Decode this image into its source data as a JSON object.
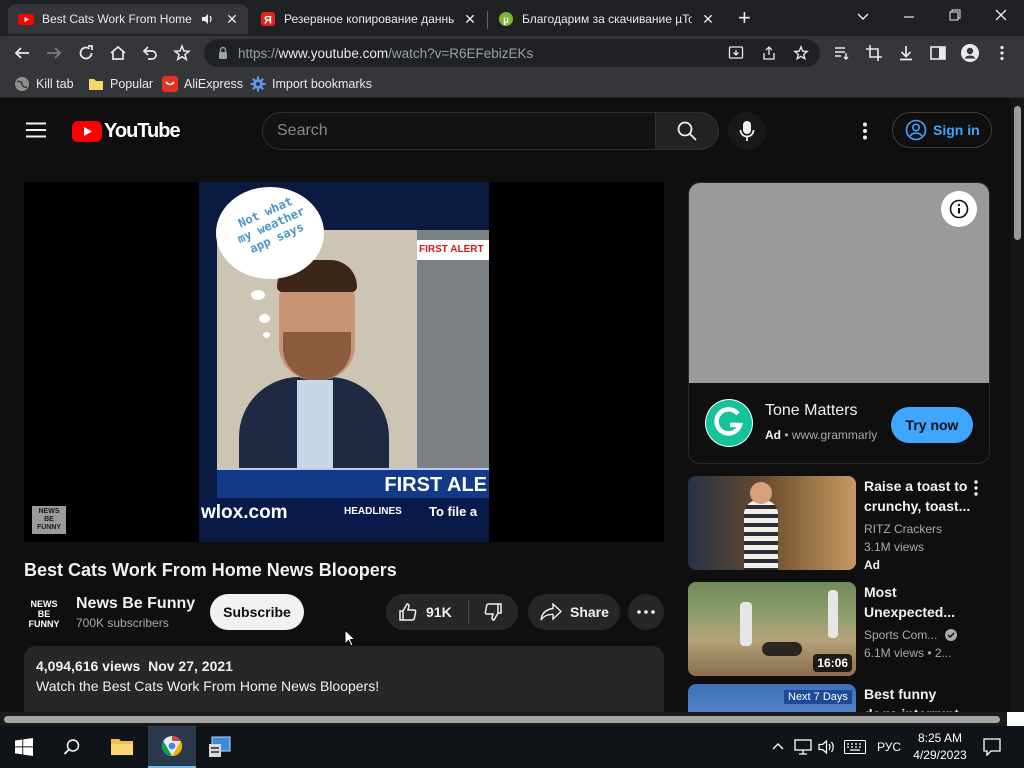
{
  "browser": {
    "tabs": [
      {
        "title": "Best Cats Work From Home",
        "close": "✕"
      },
      {
        "title": "Резервное копирование данны",
        "close": "✕"
      },
      {
        "title": "Благодарим за скачивание µTor",
        "close": "✕"
      }
    ],
    "new_tab": "+",
    "url_scheme": "https://",
    "url_host": "www.youtube.com",
    "url_path": "/watch?v=R6EFebizEKs",
    "bookmarks": [
      {
        "label": "Kill tab",
        "icon": "globe-icon"
      },
      {
        "label": "Popular",
        "icon": "folder-icon"
      },
      {
        "label": "AliExpress",
        "icon": "aliexpress-icon"
      },
      {
        "label": "Import bookmarks",
        "icon": "gear-icon"
      }
    ]
  },
  "youtube": {
    "logo_text": "YouTube",
    "search_placeholder": "Search",
    "signin_label": "Sign in",
    "video_title": "Best Cats Work From Home News Bloopers",
    "channel": {
      "name": "News Be Funny",
      "subscribers": "700K subscribers",
      "logo_lines": [
        "NEWS",
        "BE",
        "FUNNY"
      ]
    },
    "subscribe_label": "Subscribe",
    "likes": "91K",
    "share_label": "Share",
    "views_date": "4,094,616 views  Nov 27, 2021",
    "description": "Watch the Best Cats Work From Home News Bloopers!",
    "player": {
      "bubble_text": [
        "Not what",
        "my weather",
        "app says"
      ],
      "banner": "FIRST ALE",
      "site": "wlox.com",
      "ticker_1": "HEADLINES",
      "ticker_2": "To file a",
      "first_alert": "FIRST ALERT",
      "watermark_lines": [
        "NEWS",
        "BE",
        "FUNNY"
      ]
    }
  },
  "ad": {
    "title": "Tone Matters",
    "badge": "Ad",
    "site": "www.grammarly",
    "cta": "Try now"
  },
  "recommendations": [
    {
      "title_lines": [
        "Raise a toast to",
        "crunchy, toast..."
      ],
      "channel": "RITZ Crackers",
      "views": "3.1M views",
      "badge": "Ad",
      "duration": ""
    },
    {
      "title_lines": [
        "Most",
        "Unexpected..."
      ],
      "channel": "Sports Com...",
      "views": "6.1M views",
      "age": "2...",
      "duration": "16:06"
    },
    {
      "title_lines": [
        "Best funny",
        "dogs interrupt..."
      ],
      "channel": "",
      "views": "",
      "duration": "",
      "thumb_label": "Next 7 Days"
    }
  ],
  "taskbar": {
    "time": "8:25 AM",
    "date": "4/29/2023",
    "lang": "РУС"
  }
}
